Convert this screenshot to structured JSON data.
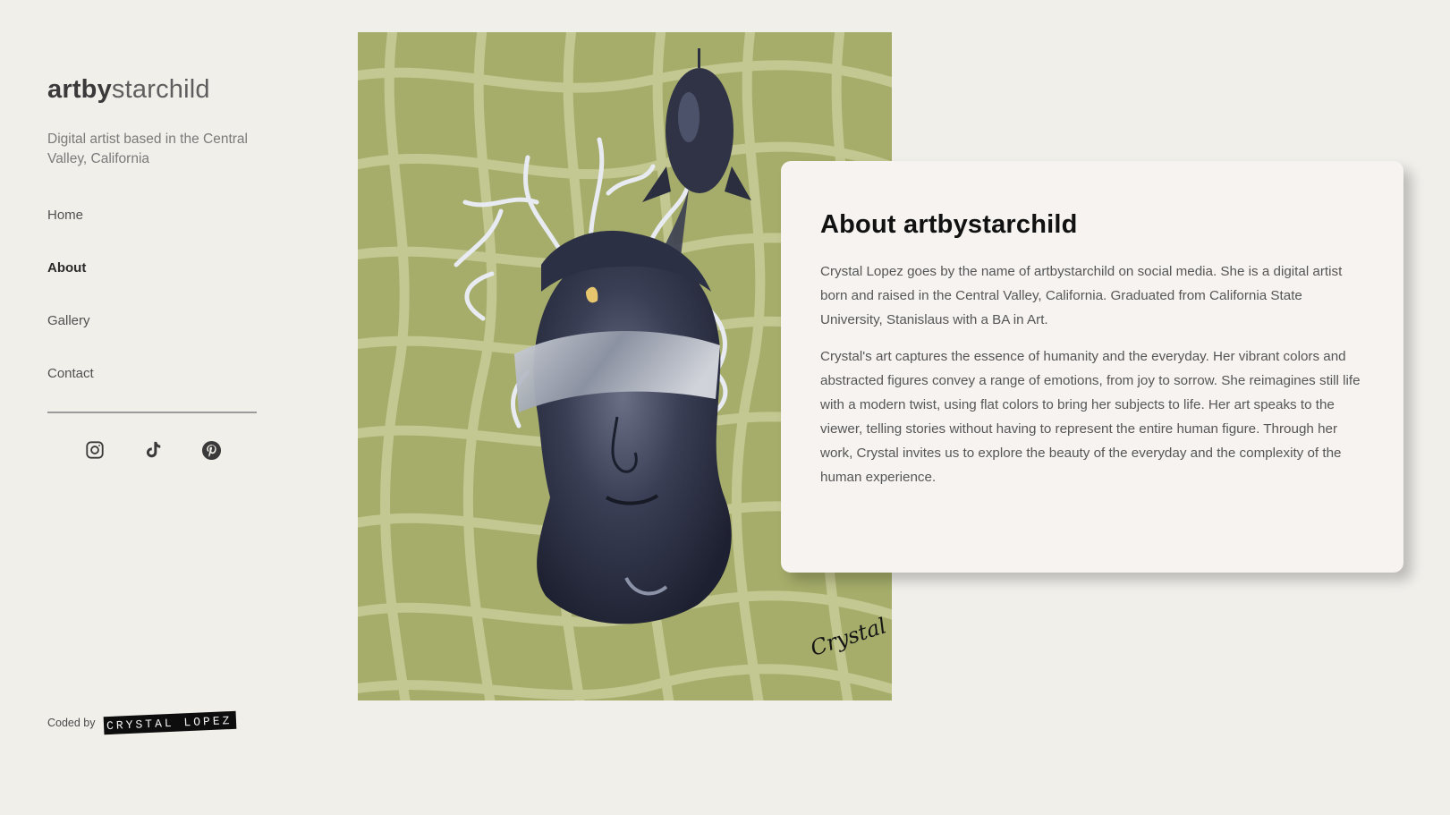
{
  "sidebar": {
    "logo_bold": "artby",
    "logo_light": "starchild",
    "tagline": "Digital artist based in the Central Valley, California",
    "nav": [
      {
        "label": "Home",
        "active": false
      },
      {
        "label": "About",
        "active": true
      },
      {
        "label": "Gallery",
        "active": false
      },
      {
        "label": "Contact",
        "active": false
      }
    ],
    "socials": [
      {
        "icon": "instagram-icon"
      },
      {
        "icon": "tiktok-icon"
      },
      {
        "icon": "pinterest-icon"
      }
    ],
    "credit": {
      "text": "Coded by",
      "tag": "CRYSTAL LOPEZ"
    }
  },
  "artwork": {
    "signature": "Crystal",
    "background_color": "#a6ad6a",
    "line_color": "#c9cc98"
  },
  "about": {
    "title": "About artbystarchild",
    "paragraphs": [
      "Crystal Lopez goes by the name of artbystarchild on social media. She is a digital artist born and raised in the Central Valley, California. Graduated from California State University, Stanislaus with a BA in Art.",
      "Crystal's art captures the essence of humanity and the everyday. Her vibrant colors and abstracted figures convey a range of emotions, from joy to sorrow. She reimagines still life with a modern twist, using flat colors to bring her subjects to life. Her art speaks to the viewer, telling stories without having to represent the entire human figure. Through her work, Crystal invites us to explore the beauty of the everyday and the complexity of the human experience."
    ]
  },
  "colors": {
    "background": "#f1efea",
    "card": "#f6f3f1",
    "text": "#565656"
  }
}
